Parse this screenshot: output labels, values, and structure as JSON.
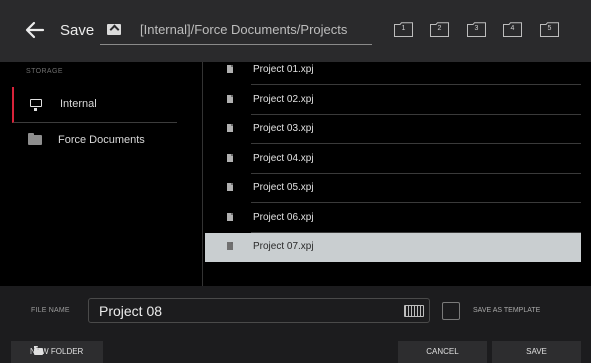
{
  "header": {
    "title": "Save",
    "path": "[Internal]/Force Documents/Projects",
    "quick_folders": [
      "1",
      "2",
      "3",
      "4",
      "5"
    ]
  },
  "storage": {
    "title": "STORAGE",
    "items": [
      {
        "label": "Internal",
        "icon": "monitor-icon",
        "selected": true
      },
      {
        "label": "Force Documents",
        "icon": "folder-icon",
        "selected": false
      }
    ]
  },
  "files": [
    "Project 01.xpj",
    "Project 02.xpj",
    "Project 03.xpj",
    "Project 04.xpj",
    "Project 05.xpj",
    "Project 06.xpj",
    "Project 07.xpj"
  ],
  "selected_file": "Project 07.xpj",
  "footer": {
    "file_name_label": "FILE NAME",
    "file_name_value": "Project 08",
    "save_as_template_label": "SAVE AS TEMPLATE",
    "new_folder_label": "NEW FOLDER",
    "cancel_label": "CANCEL",
    "save_label": "SAVE"
  },
  "colors": {
    "accent": "#d8233a",
    "selected_row": "#c9ced0"
  }
}
